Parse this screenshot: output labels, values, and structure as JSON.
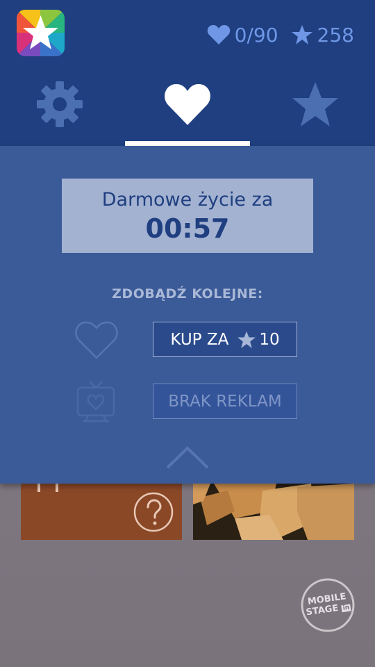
{
  "header": {
    "lives": "0/90",
    "stars": "258"
  },
  "tabs": [
    {
      "name": "settings",
      "icon": "gear-icon",
      "active": false
    },
    {
      "name": "lives",
      "icon": "heart-icon",
      "active": true
    },
    {
      "name": "stars",
      "icon": "star-icon",
      "active": false
    }
  ],
  "panel": {
    "timer_label": "Darmowe życie za",
    "timer_value": "00:57",
    "earn_title": "ZDOBĄDŹ KOLEJNE:",
    "buy_button": {
      "label": "KUP ZA",
      "cost": "10"
    },
    "ads_button": {
      "label": "BRAK REKLAM"
    }
  },
  "watermark": {
    "line1": "MOBILE",
    "line2": "STAGE",
    "badge": "in"
  },
  "colors": {
    "header_bg": "#1f3f80",
    "panel_bg": "#3b5a98",
    "accent_text": "#6f97e6",
    "timer_bg": "#a3b2d1",
    "tile_orange": "#8b4827"
  }
}
